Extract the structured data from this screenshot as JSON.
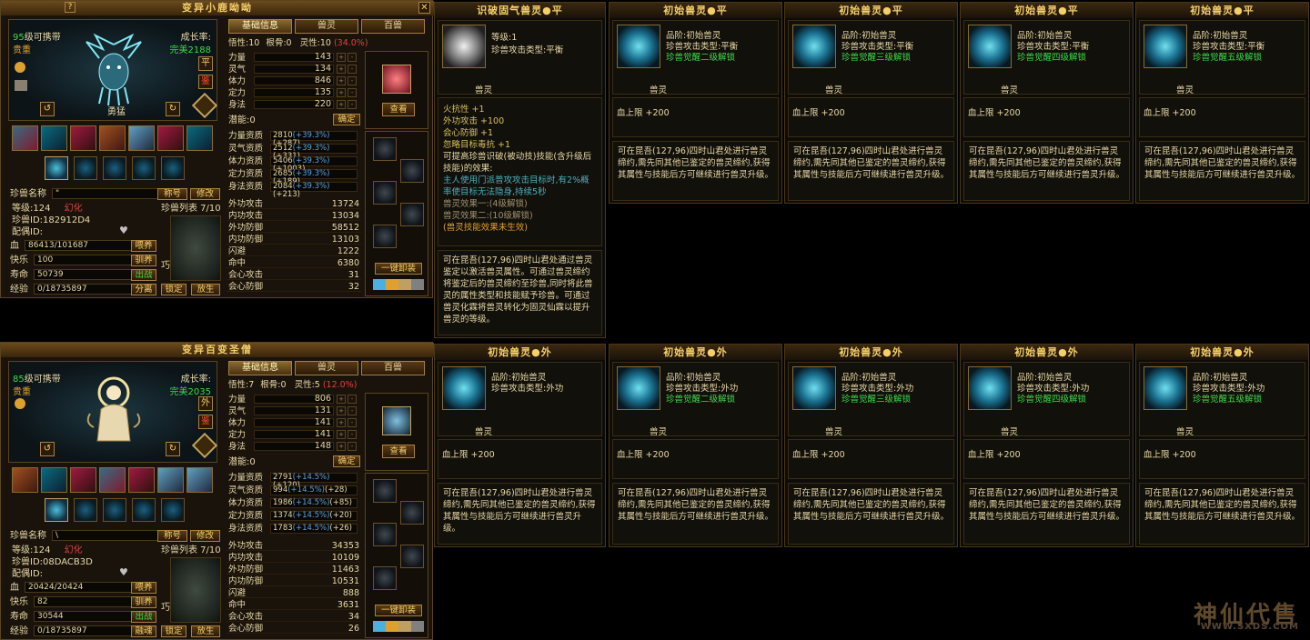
{
  "pets": [
    {
      "title": "变异小鹿呦呦",
      "level_line": "95级可携带",
      "level_num": "95",
      "level_suffix": "级可携带",
      "rarity": "贵重",
      "growth_label": "成长率:",
      "growth_value": "完美2188",
      "pet_name_on_portrait": "勇猛",
      "side_btn_1": "平",
      "side_btn_2": "鉴",
      "tabs": [
        "基础信息",
        "兽灵",
        "百兽"
      ],
      "wisdom_line": {
        "k1": "悟性:",
        "v1": "10",
        "k2": "根骨:",
        "v2": "0",
        "k3": "灵性:",
        "v3": "10",
        "v3b": "(34.0%)"
      },
      "stats": [
        {
          "k": "力量",
          "v": "143"
        },
        {
          "k": "灵气",
          "v": "134"
        },
        {
          "k": "体力",
          "v": "846"
        },
        {
          "k": "定力",
          "v": "135"
        },
        {
          "k": "身法",
          "v": "220"
        }
      ],
      "potential_label": "潜能:0",
      "confirm": "确定",
      "aptitudes": [
        {
          "k": "力量资质",
          "base": "2810",
          "pct": "(+39.3%)",
          "add": "(+287)"
        },
        {
          "k": "灵气资质",
          "base": "2512",
          "pct": "(+39.3%)",
          "add": "(+331)"
        },
        {
          "k": "体力资质",
          "base": "5406",
          "pct": "(+39.3%)",
          "add": "(+1003)"
        },
        {
          "k": "定力资质",
          "base": "2685",
          "pct": "(+39.3%)",
          "add": "(+189)"
        },
        {
          "k": "身法资质",
          "base": "2084",
          "pct": "(+39.3%)",
          "add": "(+213)"
        }
      ],
      "combat": [
        {
          "k": "外功攻击",
          "v": "13724"
        },
        {
          "k": "内功攻击",
          "v": "13034"
        },
        {
          "k": "外功防御",
          "v": "58512"
        },
        {
          "k": "内功防御",
          "v": "13103"
        },
        {
          "k": "闪避",
          "v": "1222"
        },
        {
          "k": "命中",
          "v": "6380"
        },
        {
          "k": "会心攻击",
          "v": "31"
        },
        {
          "k": "会心防御",
          "v": "32"
        }
      ],
      "name_label": "珍兽名称",
      "name_value": "\"",
      "nick_btn": "称号",
      "modify_btn": "修改",
      "grade": "等级:124",
      "transform": "幻化",
      "pet_id": "珍兽ID:182912D4",
      "spouse": "配偶ID:",
      "list_label": "珍兽列表 7/10",
      "hp_label": "血",
      "hp_value": "86413/101687",
      "happy_label": "快乐",
      "happy_value": "100",
      "life_label": "寿命",
      "life_value": "50739",
      "exp_label": "经验",
      "exp_value": "0/18735897",
      "btn_feed": "喂养",
      "btn_tame": "驯养",
      "btn_fight": "出战",
      "btn_split": "分离",
      "btn_lock": "锁定",
      "btn_release": "放生",
      "view_btn": "查看",
      "unequip_btn": "一键卸装",
      "list_glyph": "巧"
    },
    {
      "title": "变异百变圣僧",
      "level_line": "85级可携带",
      "level_num": "85",
      "level_suffix": "级可携带",
      "rarity": "贵重",
      "growth_label": "成长率:",
      "growth_value": "完美2035",
      "pet_name_on_portrait": "",
      "side_btn_1": "外",
      "side_btn_2": "鉴",
      "tabs": [
        "基础信息",
        "兽灵",
        "百兽"
      ],
      "wisdom_line": {
        "k1": "悟性:",
        "v1": "7",
        "k2": "根骨:",
        "v2": "0",
        "k3": "灵性:",
        "v3": "5",
        "v3b": "(12.0%)"
      },
      "stats": [
        {
          "k": "力量",
          "v": "806"
        },
        {
          "k": "灵气",
          "v": "131"
        },
        {
          "k": "体力",
          "v": "141"
        },
        {
          "k": "定力",
          "v": "141"
        },
        {
          "k": "身法",
          "v": "148"
        }
      ],
      "potential_label": "潜能:0",
      "confirm": "确定",
      "aptitudes": [
        {
          "k": "力量资质",
          "base": "2791",
          "pct": "(+14.5%)",
          "add": "(+120)"
        },
        {
          "k": "灵气资质",
          "base": "994",
          "pct": "(+14.5%)",
          "add": "(+28)"
        },
        {
          "k": "体力资质",
          "base": "1986",
          "pct": "(+14.5%)",
          "add": "(+85)"
        },
        {
          "k": "定力资质",
          "base": "1374",
          "pct": "(+14.5%)",
          "add": "(+20)"
        },
        {
          "k": "身法资质",
          "base": "1783",
          "pct": "(+14.5%)",
          "add": "(+26)"
        }
      ],
      "combat": [
        {
          "k": "外功攻击",
          "v": "34353"
        },
        {
          "k": "内功攻击",
          "v": "10109"
        },
        {
          "k": "外功防御",
          "v": "11463"
        },
        {
          "k": "内功防御",
          "v": "10531"
        },
        {
          "k": "闪避",
          "v": "888"
        },
        {
          "k": "命中",
          "v": "3631"
        },
        {
          "k": "会心攻击",
          "v": "34"
        },
        {
          "k": "会心防御",
          "v": "26"
        }
      ],
      "name_label": "珍兽名称",
      "name_value": "\\",
      "nick_btn": "称号",
      "modify_btn": "修改",
      "grade": "等级:124",
      "transform": "幻化",
      "pet_id": "珍兽ID:08DACB3D",
      "spouse": "配偶ID:",
      "list_label": "珍兽列表 7/10",
      "hp_label": "血",
      "hp_value": "20424/20424",
      "happy_label": "快乐",
      "happy_value": "82",
      "life_label": "寿命",
      "life_value": "30544",
      "exp_label": "经验",
      "exp_value": "0/18735897",
      "btn_feed": "喂养",
      "btn_tame": "驯养",
      "btn_fight": "出战",
      "btn_split": "融魂",
      "btn_lock": "锁定",
      "btn_release": "放生",
      "view_btn": "查看",
      "unequip_btn": "一键卸装",
      "list_glyph": "巧"
    }
  ],
  "first_card": {
    "title": "识破固气兽灵●平",
    "l1": "等级:1",
    "l2": "珍兽攻击类型:平衡",
    "pet_label": "兽灵",
    "bonuses": [
      "火抗性 +1",
      "外功攻击 +100",
      "会心防御 +1",
      "忽略目标毒抗 +1"
    ],
    "effect_intro": "可提高珍兽识破(被动技)技能(含升级后技能)的效果:",
    "effect_detail": "主人使用门派普攻攻击目标时,有2%概率使目标无法隐身,持续5秒",
    "effect1": "兽灵效果一:(4级解锁)",
    "effect2": "兽灵效果二:(10级解锁)",
    "effect_note": "(兽灵技能效果未生效)",
    "desc": "可在昆吾(127,96)四时山君处通过兽灵鉴定以激活兽灵属性。可通过兽灵缔约将鉴定后的兽灵缔约至珍兽,同时将此兽灵的属性类型和技能赋予珍兽。可通过兽灵化霖将兽灵转化为固灵仙霖以提升兽灵的等级。"
  },
  "top_cards": [
    {
      "title": "初始兽灵●平",
      "l1": "品阶:初始兽灵",
      "l2": "珍兽攻击类型:平衡",
      "l3": "珍兽觉醒二级解锁",
      "pet_label": "兽灵",
      "bonus": "血上限 +200",
      "desc": "可在昆吾(127,96)四时山君处进行兽灵缔约,需先同其他已鉴定的兽灵缔约,获得其属性与技能后方可继续进行兽灵升级。"
    },
    {
      "title": "初始兽灵●平",
      "l1": "品阶:初始兽灵",
      "l2": "珍兽攻击类型:平衡",
      "l3": "珍兽觉醒三级解锁",
      "pet_label": "兽灵",
      "bonus": "血上限 +200",
      "desc": "可在昆吾(127,96)四时山君处进行兽灵缔约,需先同其他已鉴定的兽灵缔约,获得其属性与技能后方可继续进行兽灵升级。"
    },
    {
      "title": "初始兽灵●平",
      "l1": "品阶:初始兽灵",
      "l2": "珍兽攻击类型:平衡",
      "l3": "珍兽觉醒四级解锁",
      "pet_label": "兽灵",
      "bonus": "血上限 +200",
      "desc": "可在昆吾(127,96)四时山君处进行兽灵缔约,需先同其他已鉴定的兽灵缔约,获得其属性与技能后方可继续进行兽灵升级。"
    },
    {
      "title": "初始兽灵●平",
      "l1": "品阶:初始兽灵",
      "l2": "珍兽攻击类型:平衡",
      "l3": "珍兽觉醒五级解锁",
      "pet_label": "兽灵",
      "bonus": "血上限 +200",
      "desc": "可在昆吾(127,96)四时山君处进行兽灵缔约,需先同其他已鉴定的兽灵缔约,获得其属性与技能后方可继续进行兽灵升级。"
    }
  ],
  "bottom_cards": [
    {
      "title": "初始兽灵●外",
      "l1": "品阶:初始兽灵",
      "l2": "珍兽攻击类型:外功",
      "l3": "",
      "pet_label": "兽灵",
      "bonus": "血上限 +200",
      "desc": "可在昆吾(127,96)四时山君处进行兽灵缔约,需先同其他已鉴定的兽灵缔约,获得其属性与技能后方可继续进行兽灵升级。"
    },
    {
      "title": "初始兽灵●外",
      "l1": "品阶:初始兽灵",
      "l2": "珍兽攻击类型:外功",
      "l3": "珍兽觉醒二级解锁",
      "pet_label": "兽灵",
      "bonus": "血上限 +200",
      "desc": "可在昆吾(127,96)四时山君处进行兽灵缔约,需先同其他已鉴定的兽灵缔约,获得其属性与技能后方可继续进行兽灵升级。"
    },
    {
      "title": "初始兽灵●外",
      "l1": "品阶:初始兽灵",
      "l2": "珍兽攻击类型:外功",
      "l3": "珍兽觉醒三级解锁",
      "pet_label": "兽灵",
      "bonus": "血上限 +200",
      "desc": "可在昆吾(127,96)四时山君处进行兽灵缔约,需先同其他已鉴定的兽灵缔约,获得其属性与技能后方可继续进行兽灵升级。"
    },
    {
      "title": "初始兽灵●外",
      "l1": "品阶:初始兽灵",
      "l2": "珍兽攻击类型:外功",
      "l3": "珍兽觉醒四级解锁",
      "pet_label": "兽灵",
      "bonus": "血上限 +200",
      "desc": "可在昆吾(127,96)四时山君处进行兽灵缔约,需先同其他已鉴定的兽灵缔约,获得其属性与技能后方可继续进行兽灵升级。"
    },
    {
      "title": "初始兽灵●外",
      "l1": "品阶:初始兽灵",
      "l2": "珍兽攻击类型:外功",
      "l3": "珍兽觉醒五级解锁",
      "pet_label": "兽灵",
      "bonus": "血上限 +200",
      "desc": "可在昆吾(127,96)四时山君处进行兽灵缔约,需先同其他已鉴定的兽灵缔约,获得其属性与技能后方可继续进行兽灵升级。"
    }
  ],
  "watermark": {
    "text": "神仙代售",
    "url": "WWW.SXDS.COM"
  },
  "colors": {
    "accent": "#f5cf6a",
    "green": "#3fd84a",
    "orange": "#e0a030",
    "panel": "#1a130c"
  },
  "icons": [
    "close-icon",
    "help-icon",
    "pet-portrait",
    "skill-icon",
    "spirit-slot-icon",
    "spirit-orb-icon",
    "equipment-icon"
  ]
}
